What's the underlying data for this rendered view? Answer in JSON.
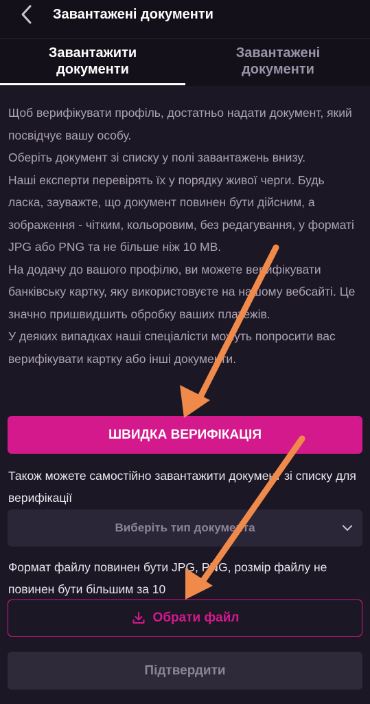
{
  "header": {
    "title": "Завантажені документи",
    "back_icon": "chevron-left-icon"
  },
  "tabs": [
    {
      "label_line1": "Завантажити",
      "label_line2": "документи",
      "active": true
    },
    {
      "label_line1": "Завантажені",
      "label_line2": "документи",
      "active": false
    }
  ],
  "description": [
    "Щоб верифікувати профіль, достатньо надати документ, який посвідчує вашу особу.",
    "Оберіть документ зі списку у полі завантажень внизу.",
    "Наші експерти перевірять їх у порядку живої черги. Будь ласка, зауважте, що документ повинен бути дійсним, а зображення - чітким, кольоровим, без редагування, у форматі JPG або PNG та не більше ніж 10 MB.",
    "На додачу до вашого профілю, ви можете верифікувати банківську картку, яку використовуєте на нашому вебсайті. Це значно пришвидшить обробку ваших платежів.",
    "У деяких випадках наші спеціалісти можуть попросити вас верифікувати картку або інші документи."
  ],
  "quick_verification_button": "ШВИДКА ВЕРИФІКАЦІЯ",
  "also_text": "Також можете самостійно завантажити документ зі списку для верифікації",
  "document_select": {
    "placeholder": "Виберіть тип документа",
    "icon": "chevron-down-icon"
  },
  "format_text": "Формат файлу повинен бути JPG, PNG, розмір файлу не повинен бути більшим за 10",
  "choose_file_button": {
    "label": "Обрати файл",
    "icon": "download-icon"
  },
  "confirm_button": "Підтвердити",
  "colors": {
    "background": "#1c1725",
    "accent": "#d4198c",
    "annotation_arrow": "#f08a4b"
  }
}
